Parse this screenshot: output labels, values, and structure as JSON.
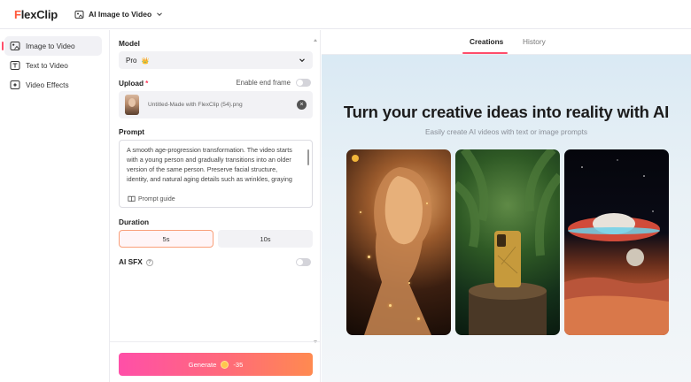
{
  "app": {
    "logo_prefix": "F",
    "logo_rest": "lexClip",
    "breadcrumb": "AI Image to Video"
  },
  "sidebar": {
    "items": [
      {
        "label": "Image to Video",
        "icon": "image-video-icon",
        "active": true
      },
      {
        "label": "Text to Video",
        "icon": "text-video-icon",
        "active": false
      },
      {
        "label": "Video Effects",
        "icon": "video-effects-icon",
        "active": false
      }
    ]
  },
  "form": {
    "model_label": "Model",
    "model_value": "Pro",
    "model_badge": "👑",
    "upload_label": "Upload",
    "upload_required": "*",
    "end_frame_label": "Enable end frame",
    "file_name": "Untitled-Made with FlexClip (54).png",
    "prompt_label": "Prompt",
    "prompt_text": "A smooth age-progression transformation. The video starts with a young person and gradually transitions into an older version of the same person. Preserve facial structure, identity, and natural aging details such as wrinkles, graying",
    "prompt_guide": "Prompt guide",
    "duration_label": "Duration",
    "durations": [
      "5s",
      "10s"
    ],
    "selected_duration": "5s",
    "sfx_label": "AI SFX",
    "generate_label": "Generate",
    "generate_cost": "-35"
  },
  "main": {
    "tabs": [
      {
        "label": "Creations",
        "active": true
      },
      {
        "label": "History",
        "active": false
      }
    ],
    "headline": "Turn your creative ideas into reality with AI",
    "subtitle": "Easily create AI videos with text or image prompts"
  },
  "colors": {
    "accent": "#ff4d6a",
    "generate_start": "#ff4fa8",
    "generate_end": "#ff8a50"
  }
}
